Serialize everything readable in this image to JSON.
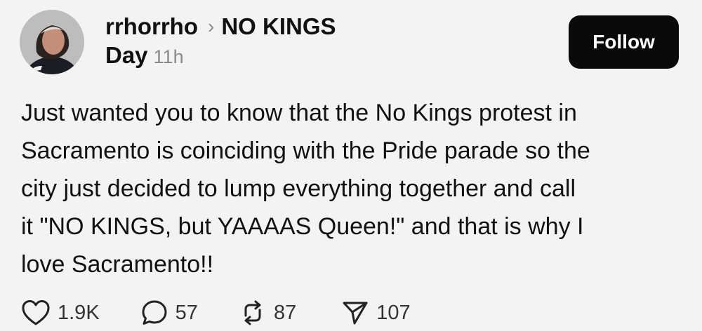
{
  "post": {
    "username": "rrhorrho",
    "separator": "›",
    "community_line1": "NO KINGS",
    "community_line2": "Day",
    "time": "11h",
    "follow_label": "Follow",
    "body_lines": [
      "Just wanted you to know that the No Kings protest in",
      "Sacramento is coinciding with the Pride parade so the",
      "city just decided to lump everything together and call",
      "it \"NO KINGS, but YAAAAS Queen!\" and that is why I",
      "love Sacramento!!"
    ],
    "likes": "1.9K",
    "comments": "57",
    "reposts": "87",
    "shares": "107"
  },
  "icons": {
    "like": "heart-icon",
    "comment": "comment-bubble-icon",
    "repost": "repost-arrows-icon",
    "share": "send-paper-plane-icon"
  },
  "colors": {
    "background": "#f3f3f3",
    "text": "#111111",
    "muted": "#8a8a8a",
    "follow_button": "#0a0a0a"
  }
}
